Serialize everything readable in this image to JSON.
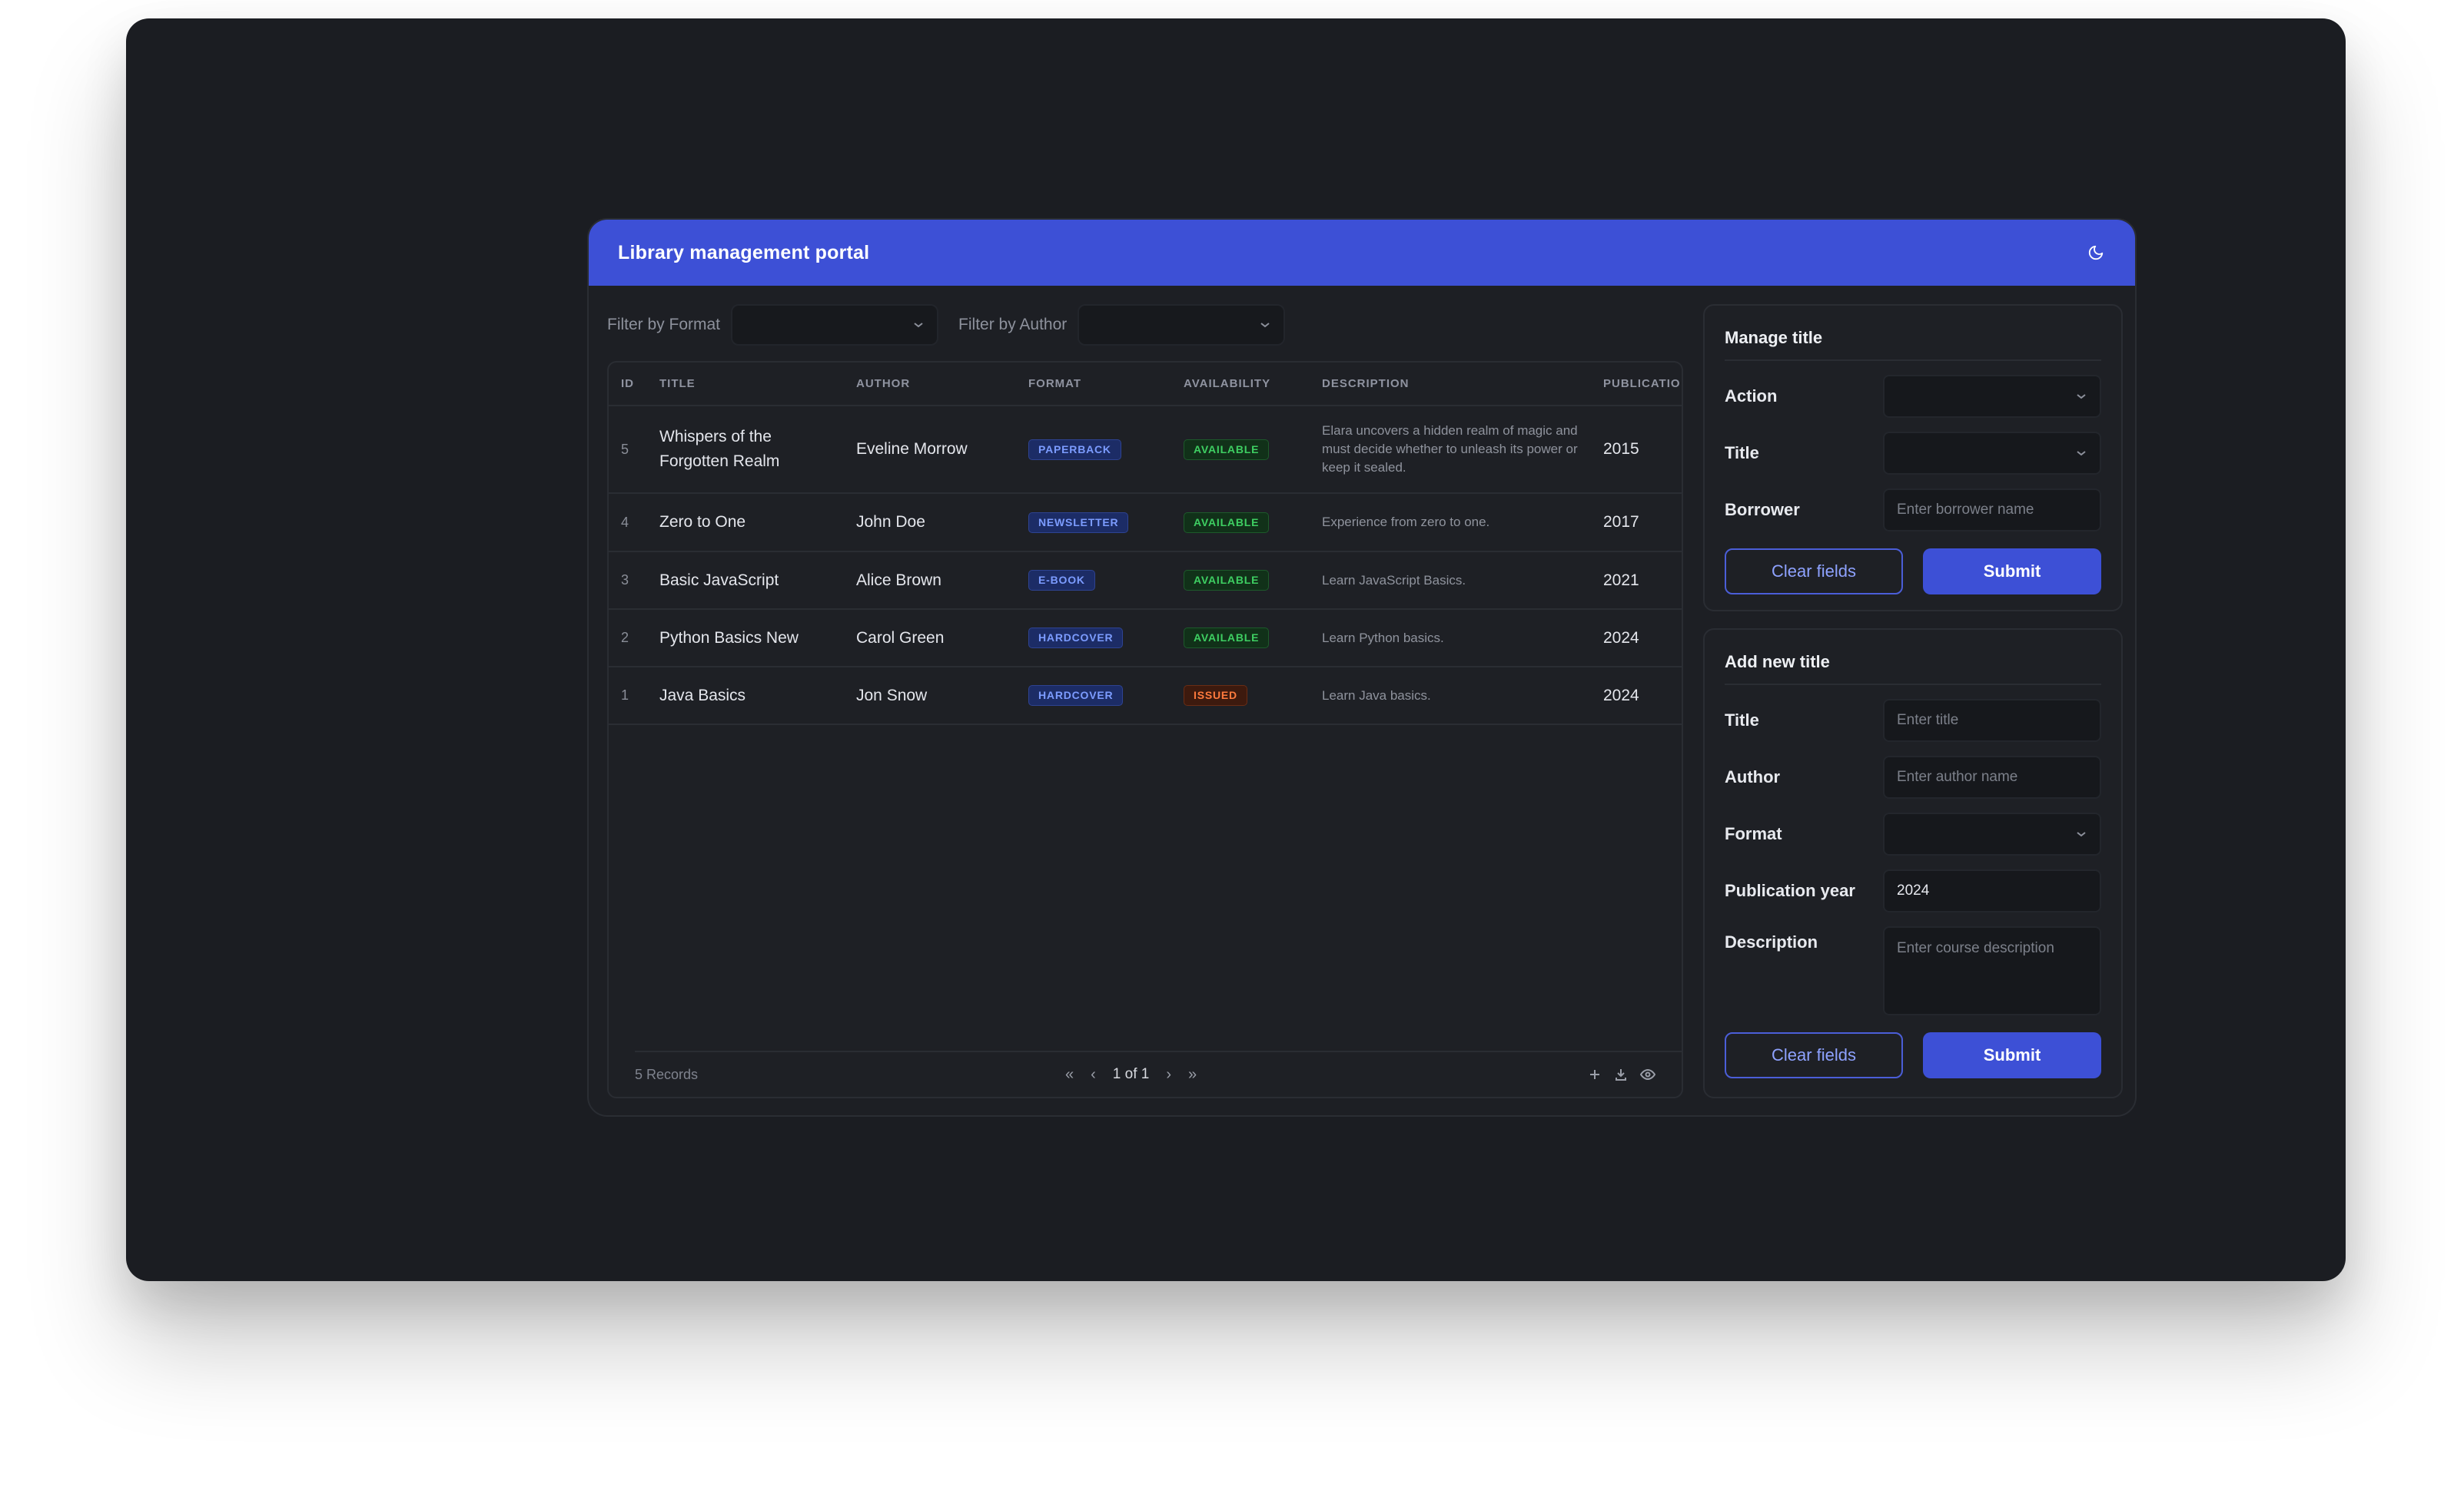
{
  "app": {
    "title": "Library management portal",
    "theme_icon": "moon-icon"
  },
  "filters": {
    "format_label": "Filter by Format",
    "format_value": "",
    "author_label": "Filter by Author",
    "author_value": ""
  },
  "table": {
    "columns": [
      "ID",
      "TITLE",
      "AUTHOR",
      "FORMAT",
      "AVAILABILITY",
      "DESCRIPTION",
      "PUBLICATIO"
    ],
    "rows": [
      {
        "id": "5",
        "title": "Whispers of the Forgotten Realm",
        "author": "Eveline Morrow",
        "format": "PAPERBACK",
        "availability": "AVAILABLE",
        "description": "Elara uncovers a hidden realm of magic and must decide whether to unleash its power or keep it sealed.",
        "year": "2015"
      },
      {
        "id": "4",
        "title": "Zero to One",
        "author": "John Doe",
        "format": "NEWSLETTER",
        "availability": "AVAILABLE",
        "description": "Experience from zero to one.",
        "year": "2017"
      },
      {
        "id": "3",
        "title": "Basic JavaScript",
        "author": "Alice Brown",
        "format": "E-BOOK",
        "availability": "AVAILABLE",
        "description": "Learn JavaScript Basics.",
        "year": "2021"
      },
      {
        "id": "2",
        "title": "Python Basics New",
        "author": "Carol Green",
        "format": "HARDCOVER",
        "availability": "AVAILABLE",
        "description": "Learn Python basics.",
        "year": "2024"
      },
      {
        "id": "1",
        "title": "Java Basics",
        "author": "Jon Snow",
        "format": "HARDCOVER",
        "availability": "ISSUED",
        "description": "Learn Java basics.",
        "year": "2024"
      }
    ],
    "footer": {
      "records": "5 Records",
      "page": "1 of 1"
    }
  },
  "manage": {
    "title": "Manage title",
    "action_label": "Action",
    "action_value": "",
    "title_label": "Title",
    "title_value": "",
    "borrower_label": "Borrower",
    "borrower_placeholder": "Enter borrower name",
    "clear_label": "Clear fields",
    "submit_label": "Submit"
  },
  "add": {
    "title": "Add new title",
    "title_label": "Title",
    "title_placeholder": "Enter title",
    "author_label": "Author",
    "author_placeholder": "Enter author name",
    "format_label": "Format",
    "format_value": "",
    "year_label": "Publication year",
    "year_value": "2024",
    "description_label": "Description",
    "description_placeholder": "Enter course description",
    "clear_label": "Clear fields",
    "submit_label": "Submit"
  },
  "colors": {
    "accent": "#3d50d6",
    "available": "#3ecf62",
    "issued": "#ff7a3d",
    "format_badge": "#7c9cff"
  }
}
